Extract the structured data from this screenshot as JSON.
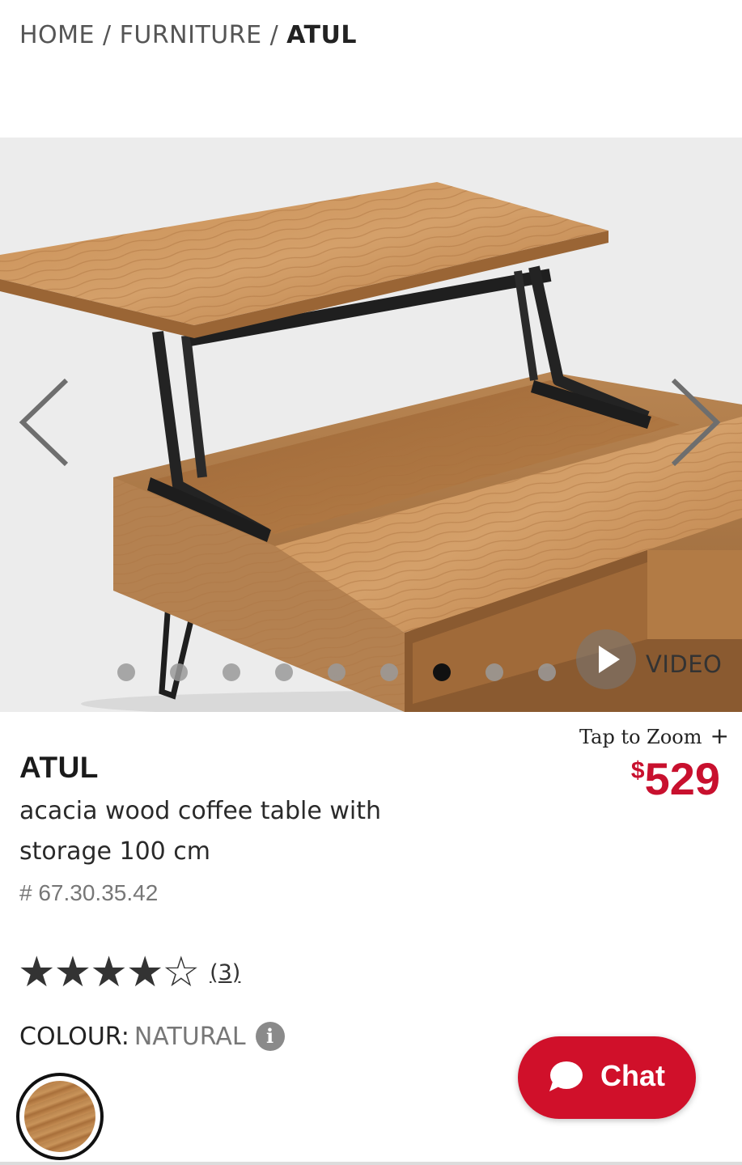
{
  "breadcrumb": {
    "home": "HOME",
    "category": "FURNITURE",
    "current": "ATUL",
    "separator": "/"
  },
  "gallery": {
    "prev_icon": "chevron-left-icon",
    "next_icon": "chevron-right-icon",
    "dots_total": 10,
    "active_dot": 7,
    "video_label": "VIDEO"
  },
  "product": {
    "zoom_label": "Tap to Zoom",
    "zoom_plus": "+",
    "currency_symbol": "$",
    "price": "529",
    "name": "ATUL",
    "description": "acacia wood coffee table with storage 100 cm",
    "sku": "# 67.30.35.42",
    "rating": {
      "stars_filled": 4,
      "stars_total": 5,
      "stars_text": "★★★★☆",
      "count": "(3)"
    },
    "colour": {
      "label": "COLOUR:",
      "value": "NATURAL",
      "info_glyph": "i"
    }
  },
  "chat": {
    "label": "Chat",
    "icon": "chat-bubble-icon"
  },
  "colors": {
    "accent": "#c8102e",
    "chat_bg": "#d0102a",
    "text": "#1e1e1e",
    "muted": "#777777"
  }
}
